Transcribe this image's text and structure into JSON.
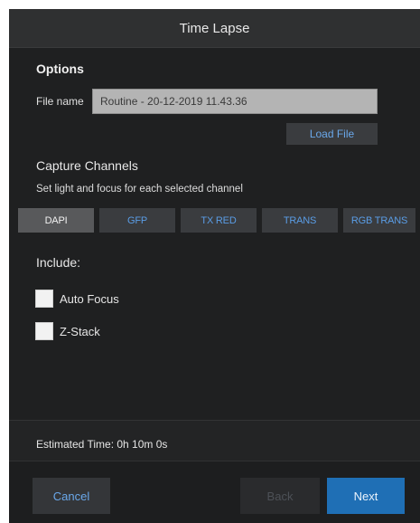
{
  "dialog": {
    "title": "Time Lapse"
  },
  "options": {
    "heading": "Options",
    "file_name_label": "File name",
    "file_name_value": "Routine - 20-12-2019 11.43.36",
    "load_file_label": "Load File"
  },
  "capture": {
    "heading": "Capture Channels",
    "description": "Set light and focus for each selected channel",
    "channels": [
      {
        "label": "DAPI",
        "active": true
      },
      {
        "label": "GFP",
        "active": false
      },
      {
        "label": "TX RED",
        "active": false
      },
      {
        "label": "TRANS",
        "active": false
      },
      {
        "label": "RGB TRANS",
        "active": false
      }
    ]
  },
  "include": {
    "heading": "Include:",
    "items": [
      {
        "label": "Auto Focus",
        "checked": false
      },
      {
        "label": "Z-Stack",
        "checked": false
      }
    ]
  },
  "estimated_time": "Estimated Time: 0h 10m 0s",
  "footer": {
    "cancel_label": "Cancel",
    "back_label": "Back",
    "next_label": "Next"
  },
  "colors": {
    "background": "#1f2021",
    "title_bar": "#2f3031",
    "accent_blue": "#1f6fb5",
    "link_blue": "#6aa8ea",
    "active_channel": "#58595b"
  }
}
